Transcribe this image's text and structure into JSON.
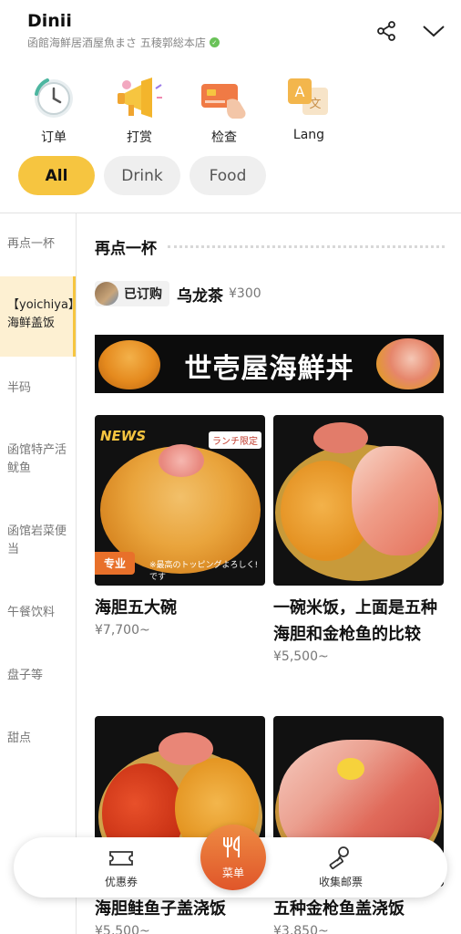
{
  "header": {
    "app_title": "Dinii",
    "store_name": "函館海鮮居酒屋魚まさ 五稜郭総本店",
    "share_icon": "share-icon",
    "collapse_icon": "chevron-down-icon"
  },
  "quick_actions": [
    {
      "label": "订单",
      "icon": "clock-icon"
    },
    {
      "label": "打赏",
      "icon": "megaphone-icon"
    },
    {
      "label": "检查",
      "icon": "card-payment-icon"
    },
    {
      "label": "Lang",
      "icon": "translate-icon"
    }
  ],
  "filters": [
    {
      "label": "All",
      "selected": true
    },
    {
      "label": "Drink",
      "selected": false
    },
    {
      "label": "Food",
      "selected": false
    }
  ],
  "sidebar": {
    "categories": [
      "再点一杯",
      "【yoichiya】海鲜盖饭",
      "半码",
      "函馆特产活鱿鱼",
      "函馆岩菜便当",
      "午餐饮料",
      "盘子等",
      "甜点"
    ],
    "active_index": 1
  },
  "main": {
    "section_title": "再点一杯",
    "reorder": {
      "badge_label": "已订购",
      "item_name": "乌龙茶",
      "price": "¥300"
    },
    "banner_text": "世壱屋海鮮丼",
    "items": [
      {
        "name": "海胆五大碗",
        "price": "¥7,700~",
        "tag": "专业",
        "news": "NEWS",
        "promo": "ランチ限定",
        "caption": "※最高のトッピングよろしく!です"
      },
      {
        "name": "一碗米饭，上面是五种海胆和金枪鱼的比较",
        "price": "¥5,500~"
      },
      {
        "name": "海胆鲑鱼子盖浇饭",
        "price": "¥5,500~"
      },
      {
        "name": "五种金枪鱼盖浇饭",
        "price": "¥3,850~"
      }
    ]
  },
  "bottom_nav": {
    "left": {
      "label": "优惠券",
      "icon": "ticket-icon"
    },
    "center": {
      "label": "菜单",
      "icon": "fork-knife-icon"
    },
    "right": {
      "label": "收集邮票",
      "icon": "stamp-icon"
    }
  },
  "colors": {
    "accent": "#f6c540",
    "fab": "#e0562a",
    "tag": "#e8702a",
    "verified": "#6ac259"
  }
}
